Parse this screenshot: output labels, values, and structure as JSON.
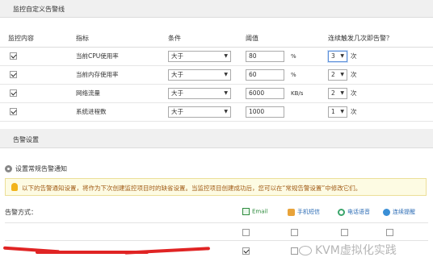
{
  "monitor_section": {
    "title": "监控自定义告警线"
  },
  "table": {
    "headers": {
      "content": "监控内容",
      "metric": "指标",
      "condition": "条件",
      "threshold": "阈值",
      "trigger": "连续触发几次即告警？"
    },
    "rows": [
      {
        "checked": true,
        "metric": "当前CPU使用率",
        "condition": "大于",
        "threshold": "80",
        "unit": "%",
        "count": "3",
        "times": "次"
      },
      {
        "checked": true,
        "metric": "当前内存使用率",
        "condition": "大于",
        "threshold": "60",
        "unit": "%",
        "count": "2",
        "times": "次"
      },
      {
        "checked": true,
        "metric": "网络流量",
        "condition": "大于",
        "threshold": "6000",
        "unit": "KB/s",
        "count": "2",
        "times": "次"
      },
      {
        "checked": true,
        "metric": "系统进程数",
        "condition": "大于",
        "threshold": "1000",
        "unit": "",
        "count": "1",
        "times": "次"
      }
    ]
  },
  "alarm_section": {
    "title": "告警设置",
    "common_label": "设置常规告警通知",
    "notice": "以下的告警通知设置，将作为下次创建监控项目时的缺省设置。当监控项目创建成功后，您可以在“常规告警设置”中修改它们。",
    "method_label": "告警方式：",
    "methods": {
      "email": "Email",
      "sms": "手机短信",
      "phone": "电话语音",
      "remind": "连续提醒"
    },
    "grid": {
      "row1": [
        false,
        false,
        false,
        false
      ],
      "row2": [
        true,
        false,
        false,
        false
      ]
    }
  },
  "watermark": "KVM虚拟化实践",
  "colors": {
    "notice_bg": "#fdfbe3",
    "notice_text": "#a05a14",
    "redaction": "#e02424",
    "link": "#2d6db5"
  }
}
